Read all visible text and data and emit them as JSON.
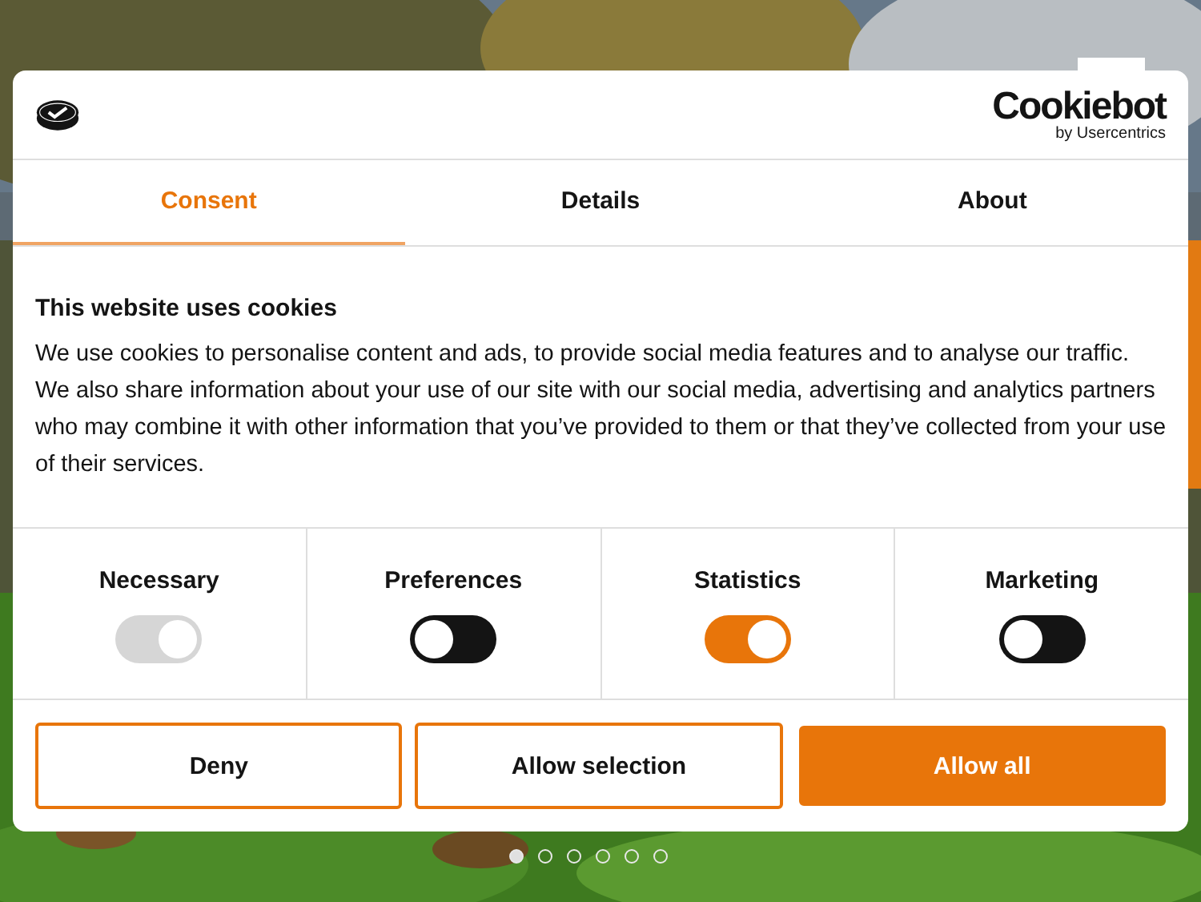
{
  "dialog": {
    "brand": {
      "name": "Cookiebot",
      "byline": "by Usercentrics"
    },
    "tabs": [
      {
        "label": "Consent",
        "selected": true
      },
      {
        "label": "Details",
        "selected": false
      },
      {
        "label": "About",
        "selected": false
      }
    ],
    "heading": "This website uses cookies",
    "text": "We use cookies to personalise content and ads, to provide social media features and to analyse our traffic. We also share information about your use of our site with our social media, advertising and analytics partners who may combine it with other information that you’ve provided to them or that they’ve collected from your use of their services.",
    "categories": [
      {
        "label": "Necessary",
        "on": true,
        "disabled": true
      },
      {
        "label": "Preferences",
        "on": false,
        "disabled": false
      },
      {
        "label": "Statistics",
        "on": true,
        "disabled": false
      },
      {
        "label": "Marketing",
        "on": false,
        "disabled": false
      }
    ],
    "buttons": [
      {
        "label": "Deny",
        "kind": "outline"
      },
      {
        "label": "Allow selection",
        "kind": "outline"
      },
      {
        "label": "Allow all",
        "kind": "filled"
      }
    ]
  },
  "carousel": {
    "dots": [
      {
        "selected": true
      },
      {
        "selected": false
      },
      {
        "selected": false
      },
      {
        "selected": false
      },
      {
        "selected": false
      },
      {
        "selected": false
      }
    ]
  }
}
